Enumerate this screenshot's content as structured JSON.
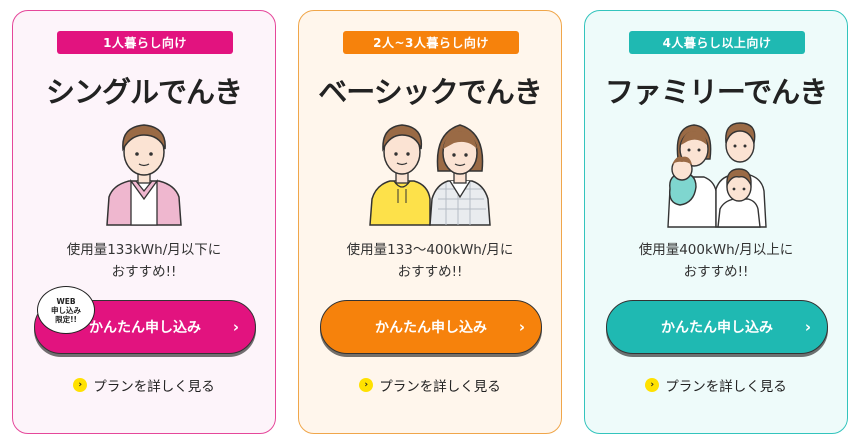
{
  "plans": [
    {
      "badge": "1人暮らし向け",
      "title": "シングルでんき",
      "desc_line1": "使用量133kWh/月以下に",
      "desc_line2": "おすすめ!!",
      "cta_label": "かんたん申し込み",
      "chevron": "›",
      "web_badge": [
        "WEB",
        "申し込み",
        "限定!!"
      ],
      "detail_label": "プランを詳しく見る",
      "detail_icon": "›",
      "illustration": "single-person-icon",
      "accent": "#e2137f"
    },
    {
      "badge": "2人~3人暮らし向け",
      "title": "ベーシックでんき",
      "desc_line1": "使用量133～400kWh/月に",
      "desc_line2": "おすすめ!!",
      "cta_label": "かんたん申し込み",
      "chevron": "›",
      "detail_label": "プランを詳しく見る",
      "detail_icon": "›",
      "illustration": "couple-icon",
      "accent": "#f6820c"
    },
    {
      "badge": "4人暮らし以上向け",
      "title": "ファミリーでんき",
      "desc_line1": "使用量400kWh/月以上に",
      "desc_line2": "おすすめ!!",
      "cta_label": "かんたん申し込み",
      "chevron": "›",
      "detail_label": "プランを詳しく見る",
      "detail_icon": "›",
      "illustration": "family-icon",
      "accent": "#1fb9b2"
    }
  ]
}
